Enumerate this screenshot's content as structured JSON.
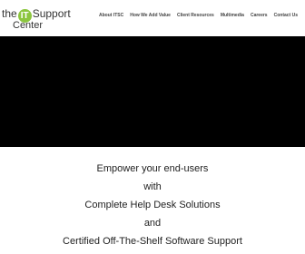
{
  "logo": {
    "prefix": "the",
    "badge": "IT",
    "word": "Support",
    "word2": "Center"
  },
  "nav": {
    "items": [
      "About ITSC",
      "How We Add Value",
      "Client Resources",
      "Multimedia",
      "Careers",
      "Contact Us"
    ]
  },
  "tagline": {
    "line1": "Empower your end-users",
    "line2": "with",
    "line3": "Complete Help Desk Solutions",
    "line4": "and",
    "line5": "Certified Off-The-Shelf Software Support"
  },
  "colors": {
    "logo_accent": "#8cc63f",
    "hero_bg": "#000000"
  }
}
